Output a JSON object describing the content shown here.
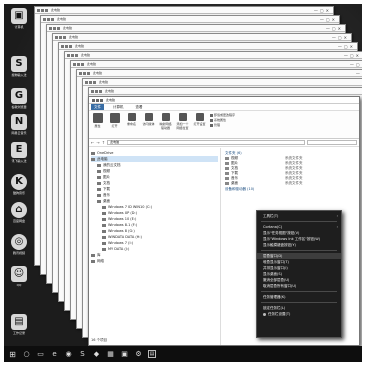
{
  "desktop": {
    "icons": [
      {
        "glyph": "▣",
        "label": "计算机"
      },
      {
        "glyph": "S",
        "label": "搜狗输入法"
      },
      {
        "glyph": "G",
        "label": "谷歌浏览器"
      },
      {
        "glyph": "N",
        "label": "网易云音乐"
      },
      {
        "glyph": "E",
        "label": "讯飞输入法"
      },
      {
        "glyph": "K",
        "label": "酷狗音乐"
      },
      {
        "glyph": "⌂",
        "label": "百度网盘"
      },
      {
        "glyph": "◎",
        "label": "腾讯视频"
      },
      {
        "glyph": "☺",
        "label": "QQ"
      },
      {
        "glyph": "▤",
        "label": "工作记录"
      }
    ]
  },
  "explorer": {
    "title": "此电脑",
    "ribbon_tabs": [
      "文件",
      "计算机",
      "查看"
    ],
    "ribbon_buttons": [
      "属性",
      "打开",
      "重命名",
      "访问媒体",
      "映射网络驱动器",
      "添加一个网络位置",
      "打开设置"
    ],
    "ribbon_small": [
      "卸载或更改程序",
      "系统属性",
      "管理"
    ],
    "address": "此电脑",
    "nav_items": [
      {
        "label": "OneDrive",
        "level": 1,
        "selected": false
      },
      {
        "label": "此电脑",
        "level": 1,
        "selected": true
      },
      {
        "label": "我的云文档",
        "level": 2,
        "selected": false
      },
      {
        "label": "视频",
        "level": 2,
        "selected": false
      },
      {
        "label": "图片",
        "level": 2,
        "selected": false
      },
      {
        "label": "文档",
        "level": 2,
        "selected": false
      },
      {
        "label": "下载",
        "level": 2,
        "selected": false
      },
      {
        "label": "音乐",
        "level": 2,
        "selected": false
      },
      {
        "label": "桌面",
        "level": 2,
        "selected": false
      },
      {
        "label": "Windows 7 ID WIN10 (C:)",
        "level": 3,
        "selected": false
      },
      {
        "label": "Windows XP (D:)",
        "level": 3,
        "selected": false
      },
      {
        "label": "Windows 10 (E:)",
        "level": 3,
        "selected": false
      },
      {
        "label": "Windows 8.1 (F:)",
        "level": 3,
        "selected": false
      },
      {
        "label": "Windows 8 (G:)",
        "level": 3,
        "selected": false
      },
      {
        "label": "WINDATA DATA (H:)",
        "level": 3,
        "selected": false
      },
      {
        "label": "Windows 7 (I:)",
        "level": 3,
        "selected": false
      },
      {
        "label": "MY DATA (J:)",
        "level": 3,
        "selected": false
      },
      {
        "label": "库",
        "level": 1,
        "selected": false
      },
      {
        "label": "网络",
        "level": 1,
        "selected": false
      }
    ],
    "status": "16 个项目",
    "section_folders": "文件夹 (6)",
    "folders": [
      {
        "name": "视频",
        "type": "系统文件夹"
      },
      {
        "name": "图片",
        "type": "系统文件夹"
      },
      {
        "name": "文档",
        "type": "系统文件夹"
      },
      {
        "name": "下载",
        "type": "系统文件夹"
      },
      {
        "name": "音乐",
        "type": "系统文件夹"
      },
      {
        "name": "桌面",
        "type": "系统文件夹"
      }
    ],
    "section_devices": "设备和驱动器 (10)"
  },
  "context_menu": {
    "items": [
      {
        "label": "工具栏(T)",
        "arrow": "›",
        "sep_after": true,
        "highlight": false,
        "icon": false
      },
      {
        "label": "Cortana(C)",
        "arrow": "›",
        "sep_after": false,
        "highlight": false,
        "icon": false
      },
      {
        "label": "显示\"任务视图\"按钮(V)",
        "arrow": "",
        "sep_after": false,
        "highlight": false,
        "icon": false
      },
      {
        "label": "显示\"Windows Ink 工作区\"按钮(W)",
        "arrow": "",
        "sep_after": false,
        "highlight": false,
        "icon": false
      },
      {
        "label": "显示触摸键盘按钮(Y)",
        "arrow": "",
        "sep_after": true,
        "highlight": false,
        "icon": false
      },
      {
        "label": "层叠窗口(D)",
        "arrow": "",
        "sep_after": false,
        "highlight": true,
        "icon": false
      },
      {
        "label": "堆叠显示窗口(T)",
        "arrow": "",
        "sep_after": false,
        "highlight": false,
        "icon": false
      },
      {
        "label": "并排显示窗口(I)",
        "arrow": "",
        "sep_after": false,
        "highlight": false,
        "icon": false
      },
      {
        "label": "显示桌面(S)",
        "arrow": "",
        "sep_after": false,
        "highlight": false,
        "icon": false
      },
      {
        "label": "撤消全部层叠(U)",
        "arrow": "",
        "sep_after": false,
        "highlight": false,
        "icon": false
      },
      {
        "label": "取消层叠所有窗口(U)",
        "arrow": "",
        "sep_after": true,
        "highlight": false,
        "icon": false
      },
      {
        "label": "任务管理器(K)",
        "arrow": "",
        "sep_after": true,
        "highlight": false,
        "icon": false
      },
      {
        "label": "锁定任务栏(L)",
        "arrow": "",
        "sep_after": false,
        "highlight": false,
        "icon": false
      },
      {
        "label": "任务栏设置(T)",
        "arrow": "",
        "sep_after": false,
        "highlight": false,
        "icon": true
      }
    ]
  },
  "taskbar": {
    "items": [
      {
        "glyph": "⊞",
        "name": "start-button"
      },
      {
        "glyph": "○",
        "name": "search-button"
      },
      {
        "glyph": "▭",
        "name": "task-view-button"
      },
      {
        "glyph": "e",
        "name": "edge-icon"
      },
      {
        "glyph": "◉",
        "name": "browser-icon"
      },
      {
        "glyph": "S",
        "name": "sogou-icon"
      },
      {
        "glyph": "◆",
        "name": "app-icon"
      },
      {
        "glyph": "▦",
        "name": "store-icon"
      },
      {
        "glyph": "▣",
        "name": "explorer-icon"
      },
      {
        "glyph": "⚙",
        "name": "settings-icon"
      },
      {
        "glyph": "▤",
        "name": "document-icon"
      }
    ]
  }
}
